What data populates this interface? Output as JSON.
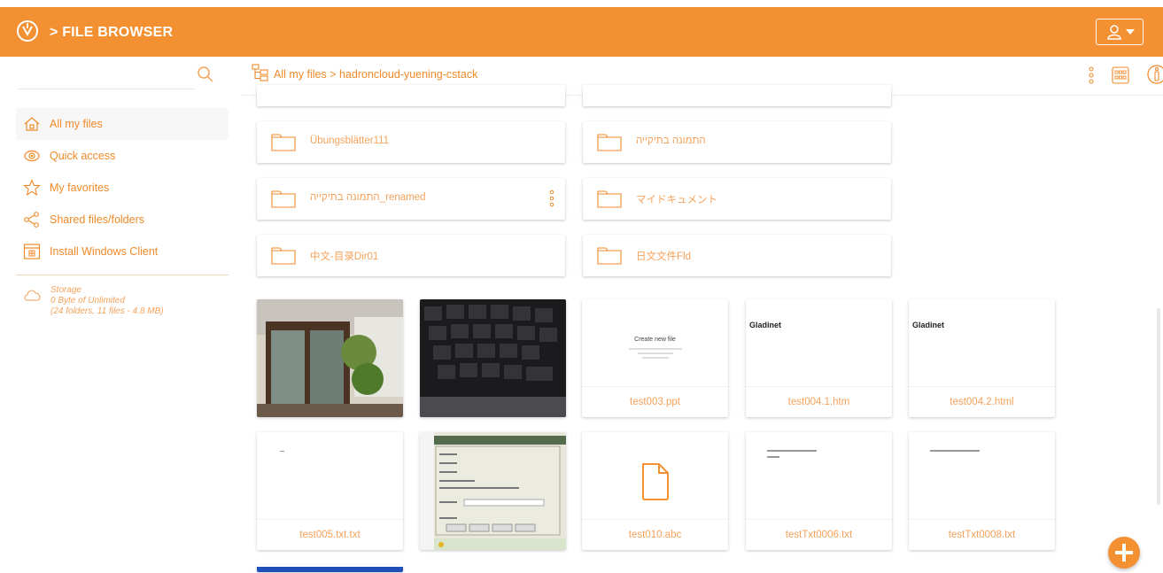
{
  "app": {
    "title": "> FILE BROWSER"
  },
  "sidebar": {
    "items": [
      {
        "label": "All my files",
        "icon": "home-icon",
        "active": true
      },
      {
        "label": "Quick access",
        "icon": "eye-icon"
      },
      {
        "label": "My favorites",
        "icon": "star-icon"
      },
      {
        "label": "Shared files/folders",
        "icon": "share-icon"
      },
      {
        "label": "Install Windows Client",
        "icon": "windows-client-icon"
      }
    ],
    "storage": {
      "title": "Storage",
      "usage": "0 Byte of Unlimited",
      "summary": "(24 folders, 11 files - 4.8 MB)"
    }
  },
  "breadcrumb": {
    "path": "All my files > hadroncloud-yuening-cstack"
  },
  "folders": [
    {
      "name": "Übungsblätter111"
    },
    {
      "name": "התמונה בתיקייה"
    },
    {
      "name": "התמונה בתיקייה_renamed"
    },
    {
      "name": "マイドキュメント"
    },
    {
      "name": "中文-目录Dir01"
    },
    {
      "name": "日文文件Fld"
    }
  ],
  "files": [
    {
      "name": "",
      "thumb": "photo-cabinet"
    },
    {
      "name": "",
      "thumb": "photo-keyboard"
    },
    {
      "name": "test003.ppt",
      "thumb_text": "Create new file"
    },
    {
      "name": "test004.1.htm",
      "thumb_text": "Gladinet"
    },
    {
      "name": "test004.2.html",
      "thumb_text": "Gladinet"
    },
    {
      "name": "test005.txt.txt",
      "thumb_text": ""
    },
    {
      "name": "",
      "thumb": "screenshot-dialog"
    },
    {
      "name": "test010.abc",
      "thumb": "document-icon"
    },
    {
      "name": "testTxt0006.txt",
      "thumb_text": ""
    },
    {
      "name": "testTxt0008.txt",
      "thumb_text": ""
    }
  ],
  "colors": {
    "accent": "#f39032",
    "text": "#f08a28"
  }
}
